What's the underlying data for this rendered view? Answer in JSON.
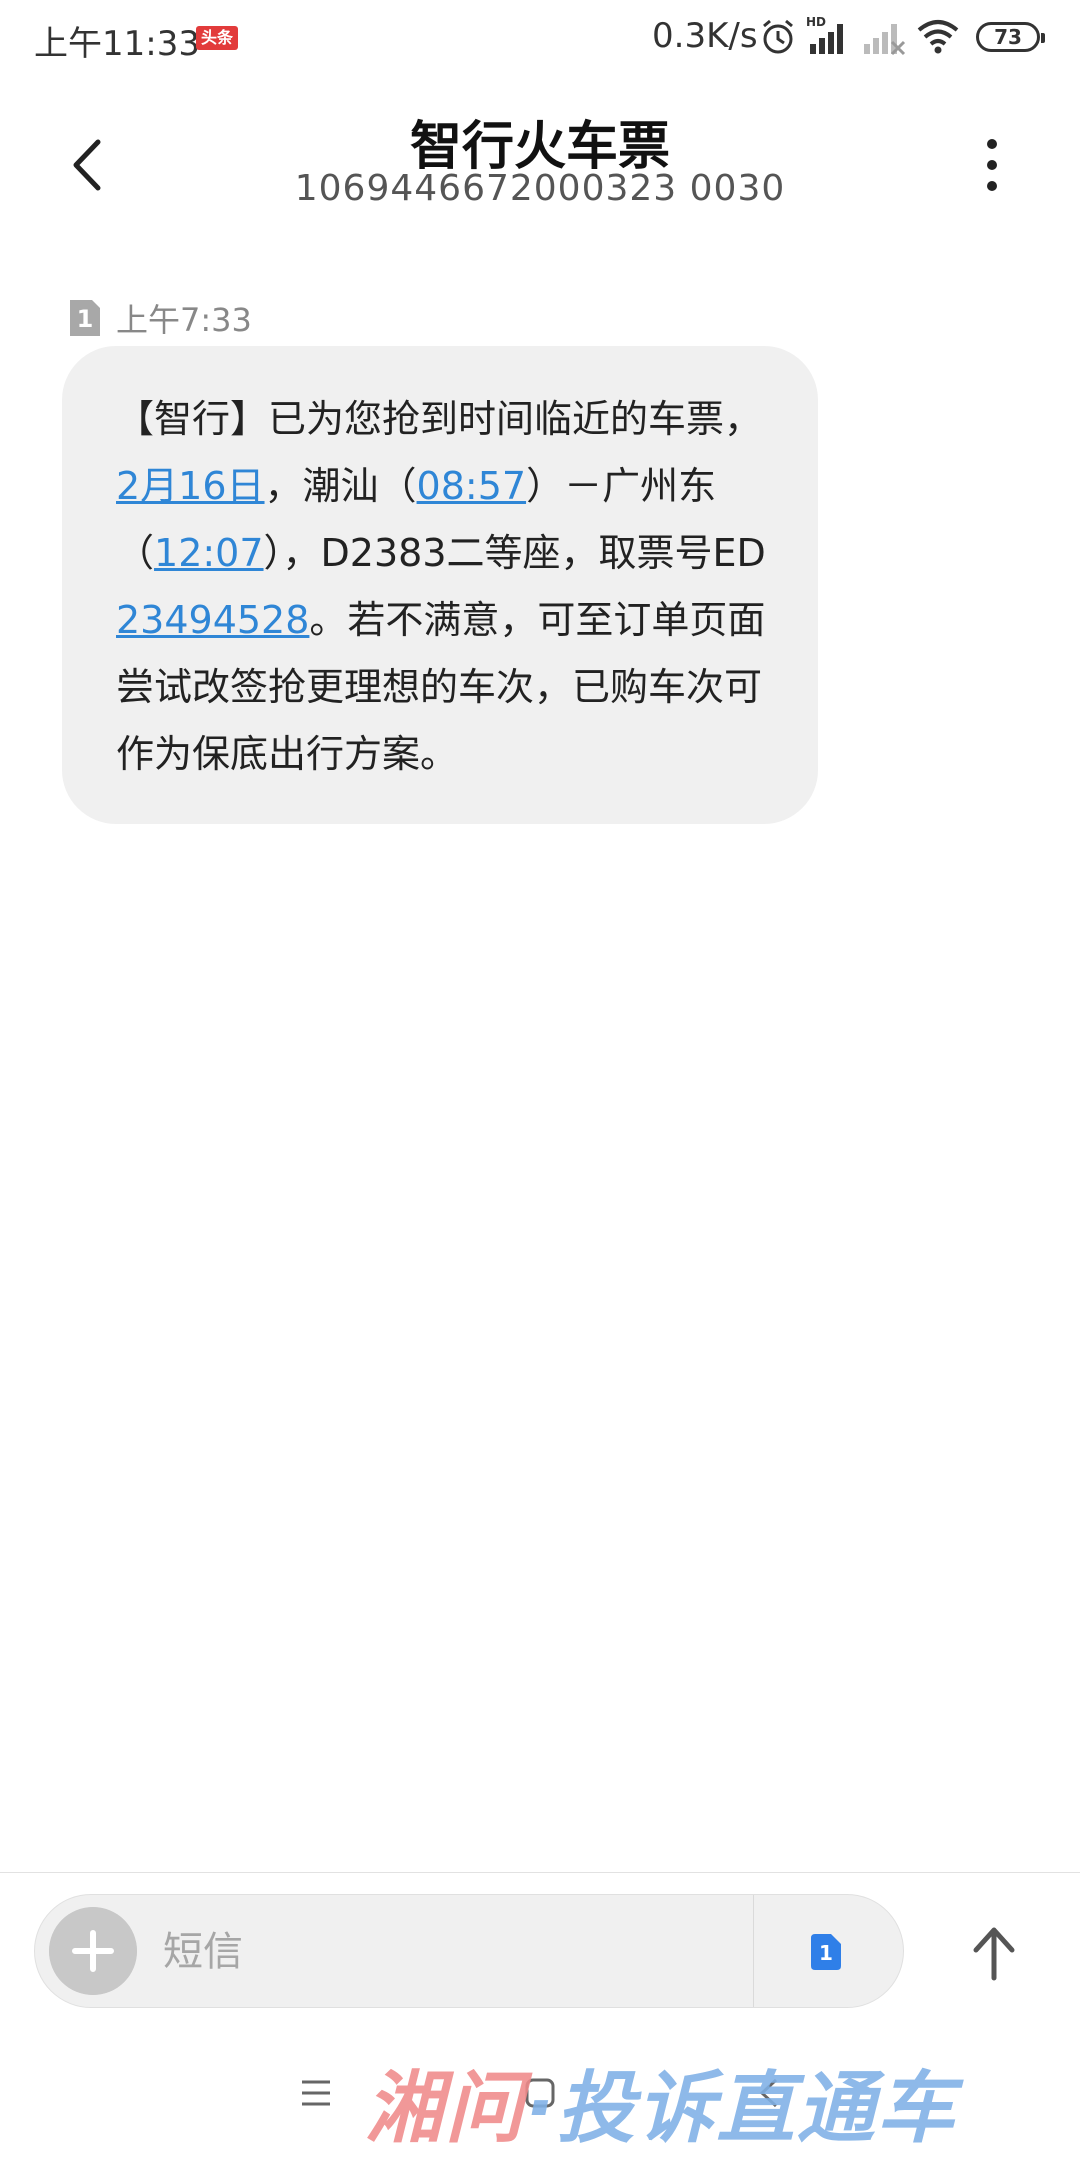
{
  "status_bar": {
    "time": "上午11:33",
    "app_badge": "头条",
    "net_speed": "0.3K/s",
    "battery": "73",
    "icons": [
      "alarm-icon",
      "hd-signal-icon",
      "signal-off-icon",
      "wifi-icon",
      "battery-icon"
    ]
  },
  "header": {
    "title": "智行火车票",
    "number": "1069446672000323 0030"
  },
  "message": {
    "sim": "1",
    "time": "上午7:33",
    "segments": [
      {
        "text": "【智行】已为您抢到时间临近的车票，",
        "link": false
      },
      {
        "text": "2月16日",
        "link": true
      },
      {
        "text": "，潮汕（",
        "link": false
      },
      {
        "text": "08:57",
        "link": true
      },
      {
        "text": "）－广州东（",
        "link": false
      },
      {
        "text": "12:07",
        "link": true
      },
      {
        "text": "），D2383二等座，取票号ED",
        "link": false
      },
      {
        "text": "23494528",
        "link": true
      },
      {
        "text": "。若不满意，可至订单页面尝试改签抢更理想的车次，已购车次可作为保底出行方案。",
        "link": false
      }
    ]
  },
  "composer": {
    "placeholder": "短信",
    "value": "",
    "sim": "1"
  },
  "watermark": {
    "part1": "湘问",
    "part2": "·投诉直通车"
  },
  "colors": {
    "link": "#2f86d6",
    "bubble": "#f0f0f0",
    "sim_badge": "#2f7fe8"
  }
}
